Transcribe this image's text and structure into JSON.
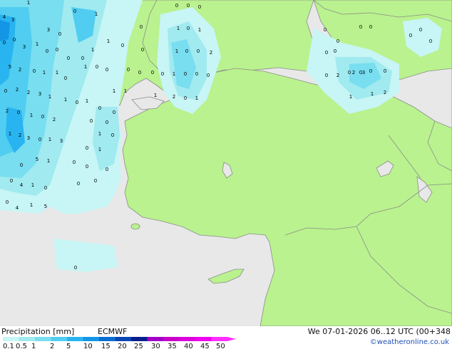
{
  "footer": {
    "title": "Precipitation [mm]",
    "model": "ECMWF",
    "datetime": "We 07-01-2026 06..12 UTC (00+348",
    "credit": "©weatheronline.co.uk"
  },
  "legend": {
    "labels": [
      "0.1",
      "0.5",
      "1",
      "2",
      "5",
      "10",
      "15",
      "20",
      "25",
      "30",
      "35",
      "40",
      "45",
      "50"
    ],
    "colors": [
      "#c8f5f5",
      "#a0eaf0",
      "#78def0",
      "#50cdf0",
      "#28b4f0",
      "#1496e6",
      "#0a6ed2",
      "#0a46b4",
      "#0a1e8c",
      "#a000c8",
      "#c800c8",
      "#dc00dc",
      "#f000f0",
      "#ff2eff"
    ]
  },
  "colors": {
    "land": "#b9f28e",
    "sea": "#e8e8e8",
    "border": "#8c8c8c"
  },
  "map_values": {
    "labels": [
      "4",
      "3",
      "1",
      "0",
      "3",
      "0",
      "1",
      "0",
      "1",
      "0",
      "0",
      "5",
      "3",
      "0",
      "0",
      "0",
      "0",
      "1",
      "1",
      "2",
      "0",
      "0",
      "2",
      "2",
      "3",
      "1",
      "2",
      "0",
      "1",
      "0",
      "2",
      "3",
      "0",
      "1",
      "2",
      "1",
      "3",
      "5",
      "1",
      "0",
      "0",
      "1",
      "4",
      "0",
      "0",
      "1",
      "4",
      "5",
      "1",
      "0",
      "0",
      "1",
      "0",
      "1",
      "0",
      "0",
      "0",
      "0",
      "1",
      "0",
      "0",
      "1",
      "0",
      "0",
      "0",
      "0",
      "0",
      "1",
      "1",
      "0",
      "0",
      "0",
      "0",
      "1",
      "0",
      "0",
      "0",
      "2",
      "0",
      "1",
      "1",
      "0",
      "0",
      "2",
      "1",
      "0",
      "1",
      "0",
      "0",
      "0",
      "1",
      "0",
      "0",
      "0",
      "0",
      "0",
      "0",
      "0",
      "2",
      "0",
      "0",
      "0",
      "0",
      "0",
      "0",
      "0",
      "2",
      "1",
      "1",
      "3",
      "2",
      "0",
      "1",
      "1",
      "0",
      "0",
      "0"
    ]
  }
}
